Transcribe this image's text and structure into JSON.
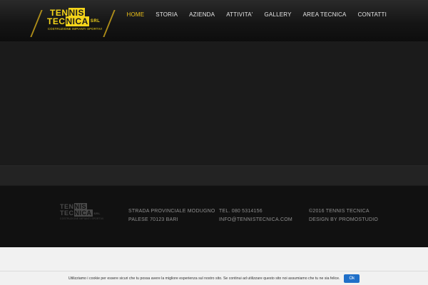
{
  "brand": {
    "line1": "TEN",
    "line1_highlight": "NIS",
    "line2": "TEC",
    "line2_highlight": "NICA",
    "suffix": "SRL",
    "subtitle": "COSTRUZIONE IMPIANTI SPORTIVI",
    "color": "#f4d41a"
  },
  "nav": {
    "items": [
      {
        "label": "HOME",
        "active": true
      },
      {
        "label": "STORIA"
      },
      {
        "label": "AZIENDA"
      },
      {
        "label": "ATTIVITA'"
      },
      {
        "label": "GALLERY"
      },
      {
        "label": "AREA TECNICA"
      },
      {
        "label": "CONTATTI"
      }
    ],
    "active_color": "#f0c419"
  },
  "footer": {
    "address_line1": "STRADA PROVINCIALE MODUGNO",
    "address_line2": "PALESE 70123 BARI",
    "phone": "TEL. 080 5314156",
    "email": "INFO@TENNISTECNICA.COM",
    "copyright": "©2016 TENNIS TECNICA",
    "design": "DESIGN BY PROMOSTUDIO"
  },
  "cookie": {
    "text": "Utilizziamo i cookie per essere sicuri che tu possa avere la migliore esperienza sul nostro sito. Se continui ad utilizzare questo sito noi assumiamo che tu ne sia felice.",
    "button": "Ok",
    "button_color": "#1f6fc8"
  }
}
